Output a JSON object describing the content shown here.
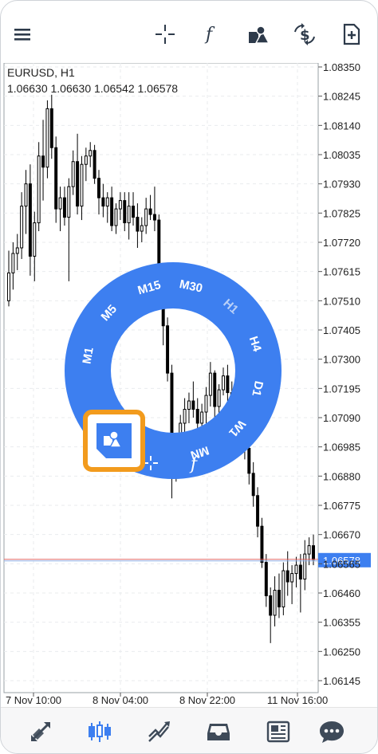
{
  "toolbar": {
    "menu_icon": "hamburger-menu-icon",
    "crosshair_icon": "crosshair-icon",
    "indicators_icon": "function-icon",
    "objects_icon": "shapes-icon",
    "symbols_icon": "dollar-exchange-icon",
    "new_order_icon": "new-order-icon"
  },
  "chart": {
    "symbol_label": "EURUSD, H1",
    "ohlc_label": "1.06630 1.06630 1.06542 1.06578",
    "current_price": "1.06578"
  },
  "chart_data": {
    "type": "candlestick",
    "title": "EURUSD, H1",
    "y_ticks": [
      "1.08350",
      "1.08245",
      "1.08140",
      "1.08035",
      "1.07930",
      "1.07825",
      "1.07720",
      "1.07615",
      "1.07510",
      "1.07405",
      "1.07300",
      "1.07195",
      "1.07090",
      "1.06985",
      "1.06880",
      "1.06775",
      "1.06670",
      "1.06565",
      "1.06460",
      "1.06355",
      "1.06250",
      "1.06145"
    ],
    "x_ticks": [
      "7 Nov 10:00",
      "8 Nov 04:00",
      "8 Nov 22:00",
      "11 Nov 16:00"
    ],
    "ylim": [
      1.0611,
      1.0838
    ],
    "current_price": 1.06578,
    "candles": [
      [
        1.0751,
        1.0769,
        1.0749,
        1.0761
      ],
      [
        1.0761,
        1.0772,
        1.0755,
        1.0768
      ],
      [
        1.0768,
        1.0775,
        1.0762,
        1.077
      ],
      [
        1.077,
        1.079,
        1.0766,
        1.0785
      ],
      [
        1.0785,
        1.0798,
        1.0775,
        1.0793
      ],
      [
        1.0793,
        1.08,
        1.076,
        1.0767
      ],
      [
        1.0767,
        1.0783,
        1.0758,
        1.0779
      ],
      [
        1.0779,
        1.0808,
        1.0776,
        1.0803
      ],
      [
        1.0803,
        1.0816,
        1.0787,
        1.0799
      ],
      [
        1.0799,
        1.0823,
        1.0795,
        1.082
      ],
      [
        1.082,
        1.0825,
        1.0802,
        1.0806
      ],
      [
        1.0806,
        1.081,
        1.0779,
        1.0784
      ],
      [
        1.0784,
        1.0792,
        1.0776,
        1.0788
      ],
      [
        1.0788,
        1.0792,
        1.0778,
        1.0781
      ],
      [
        1.0781,
        1.0795,
        1.0758,
        1.0792
      ],
      [
        1.0792,
        1.0805,
        1.0789,
        1.0801
      ],
      [
        1.0801,
        1.0811,
        1.0782,
        1.0785
      ],
      [
        1.0785,
        1.0803,
        1.078,
        1.08
      ],
      [
        1.08,
        1.0806,
        1.0794,
        1.0803
      ],
      [
        1.0803,
        1.0808,
        1.0799,
        1.0805
      ],
      [
        1.0805,
        1.0807,
        1.0793,
        1.0795
      ],
      [
        1.0795,
        1.0798,
        1.0782,
        1.0788
      ],
      [
        1.0788,
        1.0793,
        1.0781,
        1.0785
      ],
      [
        1.0785,
        1.079,
        1.0779,
        1.0788
      ],
      [
        1.0788,
        1.0792,
        1.0776,
        1.0778
      ],
      [
        1.0778,
        1.0786,
        1.0775,
        1.0784
      ],
      [
        1.0784,
        1.079,
        1.078,
        1.0787
      ],
      [
        1.0787,
        1.079,
        1.0776,
        1.0779
      ],
      [
        1.0779,
        1.079,
        1.0773,
        1.0785
      ],
      [
        1.0785,
        1.079,
        1.0778,
        1.0781
      ],
      [
        1.0781,
        1.0786,
        1.077,
        1.0776
      ],
      [
        1.0776,
        1.0781,
        1.0772,
        1.0778
      ],
      [
        1.0778,
        1.0788,
        1.0775,
        1.0784
      ],
      [
        1.0784,
        1.0789,
        1.078,
        1.0782
      ],
      [
        1.0782,
        1.0792,
        1.0776,
        1.078
      ],
      [
        1.078,
        1.0782,
        1.0755,
        1.076
      ],
      [
        1.076,
        1.0762,
        1.0735,
        1.0742
      ],
      [
        1.0742,
        1.0745,
        1.0722,
        1.0725
      ],
      [
        1.0725,
        1.0728,
        1.068,
        1.069
      ],
      [
        1.069,
        1.0698,
        1.0686,
        1.0694
      ],
      [
        1.0694,
        1.071,
        1.0691,
        1.0707
      ],
      [
        1.0707,
        1.0716,
        1.0701,
        1.0712
      ],
      [
        1.0712,
        1.0718,
        1.0707,
        1.0715
      ],
      [
        1.0715,
        1.0722,
        1.0709,
        1.0712
      ],
      [
        1.0712,
        1.0716,
        1.0703,
        1.0707
      ],
      [
        1.0707,
        1.0714,
        1.0702,
        1.0711
      ],
      [
        1.0711,
        1.072,
        1.0707,
        1.0717
      ],
      [
        1.0717,
        1.0729,
        1.0713,
        1.0725
      ],
      [
        1.0725,
        1.0726,
        1.0708,
        1.0713
      ],
      [
        1.0713,
        1.0721,
        1.071,
        1.0719
      ],
      [
        1.0719,
        1.0727,
        1.0717,
        1.0724
      ],
      [
        1.0724,
        1.0728,
        1.0715,
        1.0718
      ],
      [
        1.0718,
        1.0722,
        1.0702,
        1.0706
      ],
      [
        1.0706,
        1.0714,
        1.0703,
        1.0711
      ],
      [
        1.0711,
        1.072,
        1.0708,
        1.0716
      ],
      [
        1.0716,
        1.0719,
        1.0694,
        1.0698
      ],
      [
        1.0698,
        1.0701,
        1.0685,
        1.0689
      ],
      [
        1.0689,
        1.0693,
        1.0677,
        1.0681
      ],
      [
        1.0681,
        1.0684,
        1.0666,
        1.067
      ],
      [
        1.067,
        1.0673,
        1.0655,
        1.0657
      ],
      [
        1.0657,
        1.066,
        1.0641,
        1.0645
      ],
      [
        1.0645,
        1.0648,
        1.0628,
        1.0638
      ],
      [
        1.0638,
        1.0652,
        1.0634,
        1.0647
      ],
      [
        1.0647,
        1.0653,
        1.0637,
        1.0641
      ],
      [
        1.0641,
        1.0657,
        1.0638,
        1.0654
      ],
      [
        1.0654,
        1.0661,
        1.0645,
        1.065
      ],
      [
        1.065,
        1.0656,
        1.0642,
        1.0653
      ],
      [
        1.0653,
        1.0659,
        1.0648,
        1.0656
      ],
      [
        1.0656,
        1.066,
        1.0639,
        1.0651
      ],
      [
        1.0651,
        1.0665,
        1.0647,
        1.066
      ],
      [
        1.066,
        1.0666,
        1.0656,
        1.0663
      ],
      [
        1.0663,
        1.0667,
        1.0656,
        1.0658
      ]
    ]
  },
  "wheel": {
    "timeframes": [
      "M1",
      "M5",
      "M15",
      "M30",
      "H1",
      "H4",
      "D1",
      "W1",
      "MN"
    ],
    "selected": "H1",
    "bottom_icons": [
      "crosshair-icon",
      "function-icon"
    ],
    "selected_action_icon": "shapes-icon",
    "ring_color": "#3d7ff0",
    "highlight_color": "#f29b1d"
  },
  "bottom_nav": {
    "items": [
      {
        "name": "quotes",
        "icon": "quotes-arrows-icon",
        "active": false
      },
      {
        "name": "chart",
        "icon": "candlestick-chart-icon",
        "active": true
      },
      {
        "name": "trade",
        "icon": "trade-trend-icon",
        "active": false
      },
      {
        "name": "history",
        "icon": "history-inbox-icon",
        "active": false
      },
      {
        "name": "news",
        "icon": "news-icon",
        "active": false
      },
      {
        "name": "messages",
        "icon": "chat-messages-icon",
        "active": false
      }
    ],
    "active_color": "#3d7ff0",
    "inactive_color": "#3e4a59"
  }
}
